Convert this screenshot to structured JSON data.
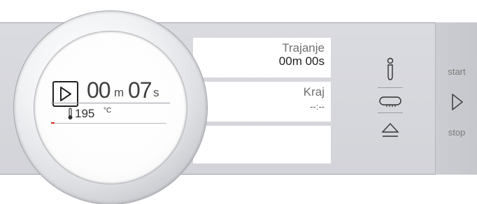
{
  "dial": {
    "minutes": "00",
    "minutes_unit": "m",
    "seconds": "07",
    "seconds_unit": "s",
    "temperature": "195",
    "temperature_unit": "°C",
    "icons": [
      "play-icon",
      "thermometer-icon"
    ]
  },
  "info": {
    "duration_label": "Trajanje",
    "duration_value": "00m 00s",
    "end_label": "Kraj",
    "end_value": "--:--"
  },
  "side_icons": [
    "meat-probe-icon",
    "child-lock-key-icon",
    "door-open-icon"
  ],
  "start_stop": {
    "start_label": "start",
    "stop_label": "stop",
    "icon": "play-icon"
  },
  "colors": {
    "accent_red": "#d42a1f",
    "panel_bg": "#d6d7dc"
  }
}
